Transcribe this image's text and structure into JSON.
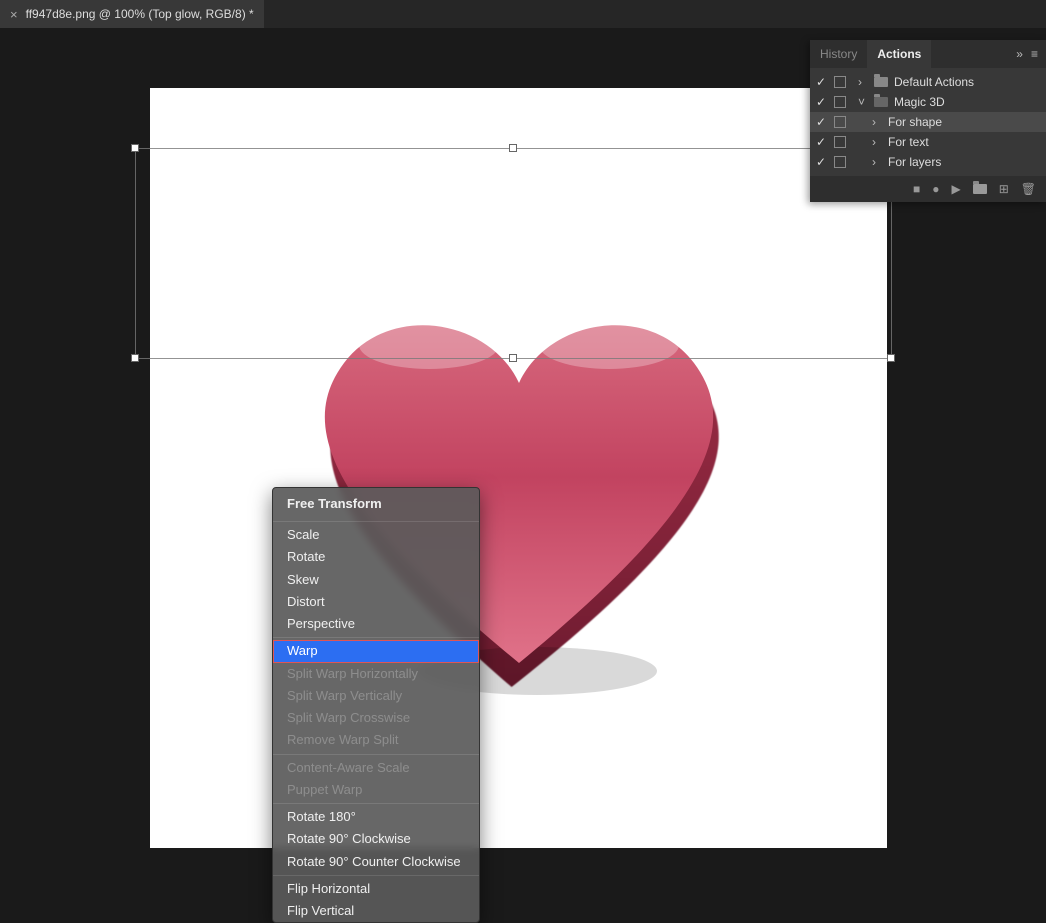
{
  "tab": {
    "title": "ff947d8e.png @ 100% (Top glow, RGB/8) *"
  },
  "context_menu": {
    "title": "Free Transform",
    "groups": [
      [
        {
          "label": "Scale",
          "disabled": false
        },
        {
          "label": "Rotate",
          "disabled": false
        },
        {
          "label": "Skew",
          "disabled": false
        },
        {
          "label": "Distort",
          "disabled": false
        },
        {
          "label": "Perspective",
          "disabled": false
        }
      ],
      [
        {
          "label": "Warp",
          "disabled": false,
          "selected": true
        },
        {
          "label": "Split Warp Horizontally",
          "disabled": true
        },
        {
          "label": "Split Warp Vertically",
          "disabled": true
        },
        {
          "label": "Split Warp Crosswise",
          "disabled": true
        },
        {
          "label": "Remove Warp Split",
          "disabled": true
        }
      ],
      [
        {
          "label": "Content-Aware Scale",
          "disabled": true
        },
        {
          "label": "Puppet Warp",
          "disabled": true
        }
      ],
      [
        {
          "label": "Rotate 180°",
          "disabled": false
        },
        {
          "label": "Rotate 90° Clockwise",
          "disabled": false
        },
        {
          "label": "Rotate 90° Counter Clockwise",
          "disabled": false
        }
      ],
      [
        {
          "label": "Flip Horizontal",
          "disabled": false
        },
        {
          "label": "Flip Vertical",
          "disabled": false
        }
      ]
    ]
  },
  "actions_panel": {
    "tabs": {
      "history": "History",
      "actions": "Actions"
    },
    "rows": [
      {
        "label": "Default Actions",
        "indent": 1,
        "checked": true,
        "folder": true,
        "open": false,
        "chev": "›"
      },
      {
        "label": "Magic 3D",
        "indent": 1,
        "checked": true,
        "folder": true,
        "open": true,
        "chev": "˅"
      },
      {
        "label": "For shape",
        "indent": 2,
        "checked": true,
        "folder": false,
        "chev": "›",
        "selected": true
      },
      {
        "label": "For text",
        "indent": 2,
        "checked": true,
        "folder": false,
        "chev": "›"
      },
      {
        "label": "For layers",
        "indent": 2,
        "checked": true,
        "folder": false,
        "chev": "›"
      }
    ]
  }
}
